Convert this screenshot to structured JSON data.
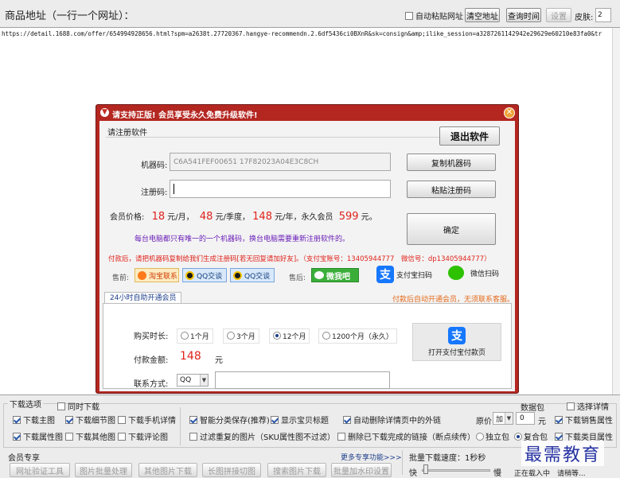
{
  "header": {
    "title": "商品地址（一行一个网址）：",
    "auto_paste_label": "自动粘贴网址",
    "clear_label": "清空地址",
    "query_time_label": "查询时间",
    "settings_label": "设置",
    "skin_label": "皮肤:",
    "skin_value": "2"
  },
  "url_text": "https://detail.1688.com/offer/654994928656.html?spm=a2638t.27720367.hangye-recommendn.2.6df5436ci0BXnR&sk=consign&amp;ilike_session=a3287261142942e29629e60210e83fa0&tr",
  "dialog": {
    "title": "请支持正版! 会员享受永久免费升级软件!",
    "register_group": "请注册软件",
    "exit_label": "退出软件",
    "machine_code_label": "机器码:",
    "machine_code_value": "C6A541FEF00651 17F82023A04E3C8CH",
    "copy_machine_label": "复制机器码",
    "reg_code_label": "注册码:",
    "paste_reg_label": "粘贴注册码",
    "price_label": "会员价格:",
    "price_month": "18",
    "unit_month": "元/月，",
    "price_quarter": "48",
    "unit_quarter": "元/季度，",
    "price_year": "148",
    "unit_year": "元/年，永久会员",
    "price_forever": "599",
    "unit_forever": "元。",
    "notice": "每台电脑都只有唯一的一个机器码，换台电脑需要重新注册软件的。",
    "confirm_label": "确定",
    "payment_notice": "付款后，请把机器码复制给我们生成注册码[若无回复请加好友]。（支付宝账号：13405944777　微信号：dp13405944777）",
    "presale_label": "售前:",
    "taobao_label": "淘宝联系",
    "qq1_label": "QQ交谈",
    "qq2_label": "QQ交谈",
    "aftersale_label": "售后:",
    "weixin_label": "微我吧",
    "alipay_scan_label": "支付宝扫码",
    "wechat_scan_label": "微信扫码",
    "tab_label": "24小时自助开通会员",
    "tab_right_notice": "付款后自动开通会员，无须联系客服。",
    "duration_label": "购买时长:",
    "opt_1m": "1个月",
    "opt_3m": "3个月",
    "opt_12m": "12个月",
    "opt_forever": "1200个月（永久）",
    "pay_amount_label": "付款金额:",
    "pay_amount_value": "148",
    "pay_amount_unit": "元",
    "contact_label": "联系方式:",
    "contact_type": "QQ",
    "open_alipay_label": "打开支付宝付款页"
  },
  "options": {
    "group_label": "下载选项",
    "sync_download": "同时下载",
    "main_img": "下载主图",
    "detail_img": "下载细节图",
    "mobile_detail": "下载手机详情",
    "attr_img": "下载属性图",
    "other_img": "下载其他图",
    "comment_img": "下载评论图",
    "smart_save": "智能分类保存(推荐)",
    "show_title": "显示宝贝标题",
    "auto_delete_ext": "自动删除详情页中的外链",
    "filter_dup": "过滤重复的图片（SKU属性图不过滤）",
    "delete_done": "删除已下载完成的链接（断点续传）",
    "data_pack": "数据包",
    "fill_detail": "选择详情",
    "price_label": "原价",
    "price_op": "加",
    "price_value": "0",
    "price_unit": "元",
    "sales_attr": "下载销售属性",
    "single_pack": "独立包",
    "combined_pack": "复合包",
    "category_attr": "下载类目属性"
  },
  "member": {
    "group_label": "会员专享",
    "more_link": "更多专享功能>>>",
    "btn1": "网址验证工具",
    "btn2": "图片批量处理",
    "btn3": "其他图片下载",
    "btn4": "长图拼接切图",
    "btn5": "搜索图片下载",
    "btn6": "批量加水印设置"
  },
  "speed": {
    "label": "批量下载速度：1秒秒",
    "fast": "快",
    "slow": "慢"
  },
  "status": {
    "text1": "正在载入中",
    "text2": "请稍等..."
  },
  "watermark": "最需教育",
  "colors": {
    "accent_red": "#e0231b",
    "dialog_frame": "#b42721",
    "link_blue": "#1d3e8a"
  }
}
